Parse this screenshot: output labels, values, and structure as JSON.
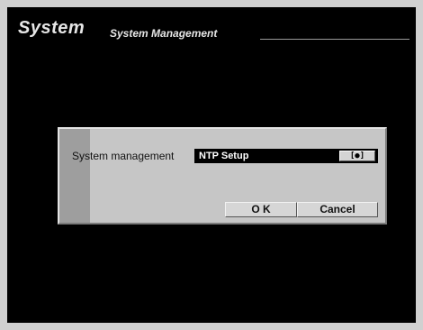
{
  "header": {
    "title": "System",
    "subtitle": "System Management"
  },
  "dialog": {
    "label": "System management",
    "select": {
      "value": "NTP Setup",
      "button_label": "[●]"
    },
    "ok_label": "O K",
    "cancel_label": "Cancel"
  }
}
